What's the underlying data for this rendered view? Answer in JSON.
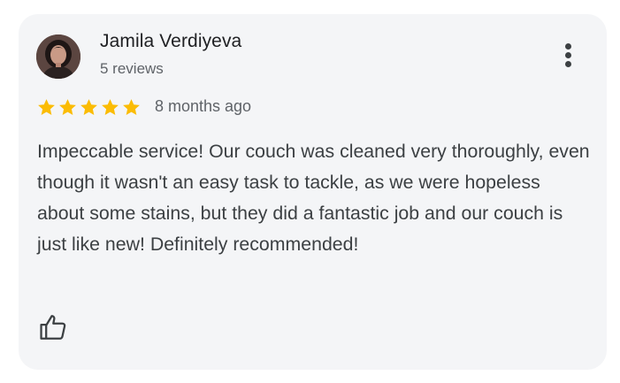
{
  "review": {
    "author_name": "Jamila Verdiyeva",
    "author_reviews": "5 reviews",
    "rating": 5,
    "rating_max": 5,
    "time_ago": "8 months ago",
    "text": "Impeccable service! Our couch was cleaned very thoroughly, even though it wasn't an easy task to tackle, as we were hopeless about some stains, but they did a fantastic job and our couch is just like new! Definitely recommended!",
    "icons": {
      "menu": "more-vert-icon",
      "like": "thumbs-up-icon",
      "star": "star-icon"
    },
    "colors": {
      "star": "#fbbc04",
      "card_background": "#f4f5f7",
      "name_text": "#202124",
      "secondary_text": "#5f6368"
    }
  }
}
